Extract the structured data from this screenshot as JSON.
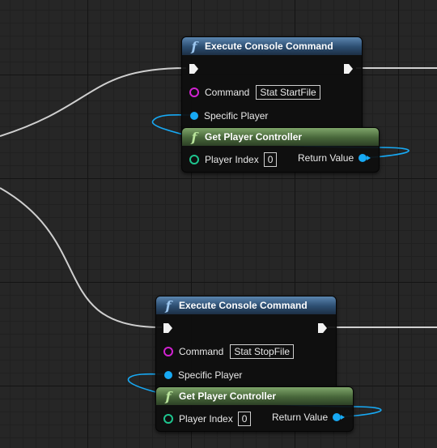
{
  "groups": [
    {
      "execute": {
        "title": "Execute Console Command",
        "command_label": "Command",
        "command_value": "Stat StartFile",
        "player_label": "Specific Player"
      },
      "controller": {
        "title": "Get Player Controller",
        "index_label": "Player Index",
        "index_value": "0",
        "return_label": "Return Value"
      }
    },
    {
      "execute": {
        "title": "Execute Console Command",
        "command_label": "Command",
        "command_value": "Stat StopFile",
        "player_label": "Specific Player"
      },
      "controller": {
        "title": "Get Player Controller",
        "index_label": "Player Index",
        "index_value": "0",
        "return_label": "Return Value"
      }
    }
  ],
  "colors": {
    "exec_header": "#2c4d70",
    "pure_header": "#47663a",
    "object_pin": "#17a9f4",
    "string_pin": "#d122d1",
    "int_pin": "#1ec48e",
    "exec_wire": "#d8d8d8"
  }
}
